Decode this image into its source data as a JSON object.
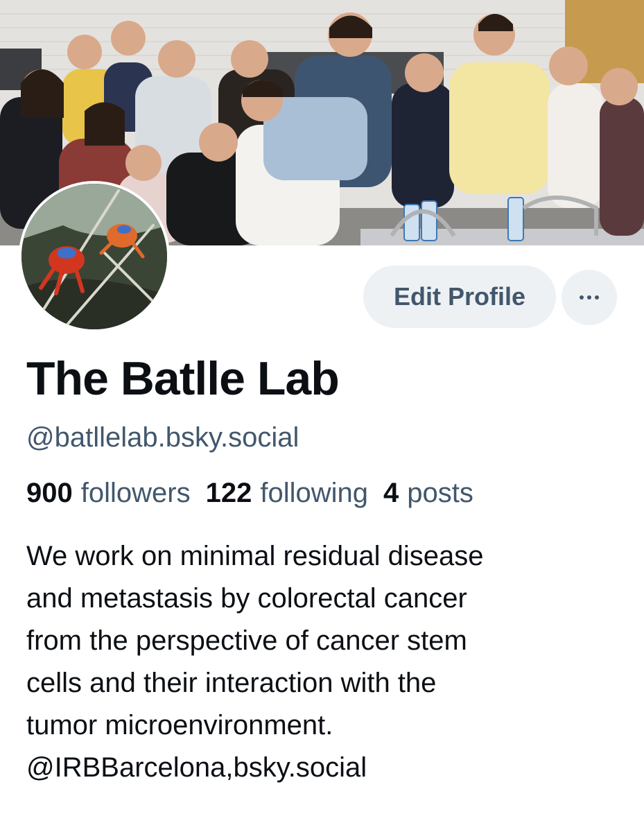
{
  "banner": {
    "description_icon": "group-photo"
  },
  "avatar": {
    "description_icon": "crab-photo"
  },
  "actions": {
    "edit_profile_label": "Edit Profile",
    "more_icon": "ellipsis-icon"
  },
  "profile": {
    "display_name": "The Batlle Lab",
    "handle": "@batllelab.bsky.social"
  },
  "stats": {
    "followers_count": "900",
    "followers_label": "followers",
    "following_count": "122",
    "following_label": "following",
    "posts_count": "4",
    "posts_label": "posts"
  },
  "bio": {
    "lines": [
      "We work on minimal residual disease",
      "and metastasis by colorectal cancer",
      "from the perspective of cancer stem",
      "cells and their interaction with the",
      "tumor microenvironment.",
      "@IRBBarcelona,bsky.social"
    ]
  },
  "colors": {
    "text_primary": "#0b0f14",
    "text_secondary": "#42576c",
    "button_bg": "#eef1f4"
  }
}
